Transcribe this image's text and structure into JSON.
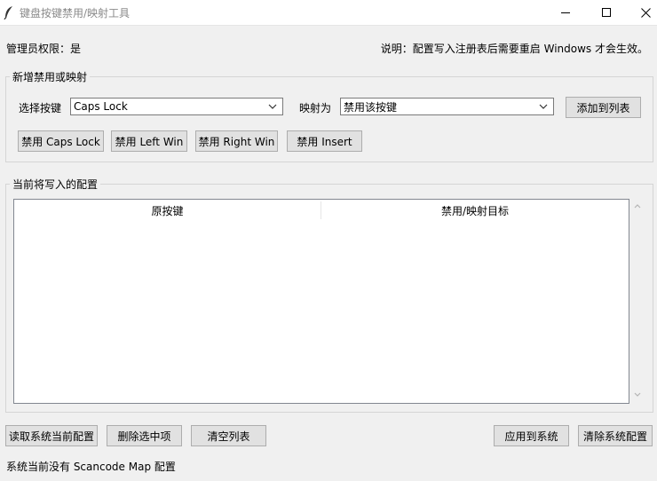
{
  "window": {
    "title": "键盘按键禁用/映射工具",
    "icon": "feather-icon"
  },
  "info": {
    "admin": "管理员权限：是",
    "note": "说明：配置写入注册表后需要重启 Windows 才会生效。"
  },
  "new_section": {
    "legend": "新增禁用或映射",
    "select_key_label": "选择按键",
    "select_key_value": "Caps Lock",
    "map_to_label": "映射为",
    "map_to_value": "禁用该按键",
    "add_button": "添加到列表",
    "quick_buttons": [
      "禁用 Caps Lock",
      "禁用 Left Win",
      "禁用 Right Win",
      "禁用 Insert"
    ]
  },
  "current_section": {
    "legend": "当前将写入的配置",
    "columns": [
      "原按键",
      "禁用/映射目标"
    ],
    "rows": []
  },
  "bottom_buttons": {
    "read": "读取系统当前配置",
    "delete": "删除选中项",
    "clear": "清空列表",
    "apply": "应用到系统",
    "clear_system": "清除系统配置"
  },
  "status": "系统当前没有 Scancode Map 配置"
}
